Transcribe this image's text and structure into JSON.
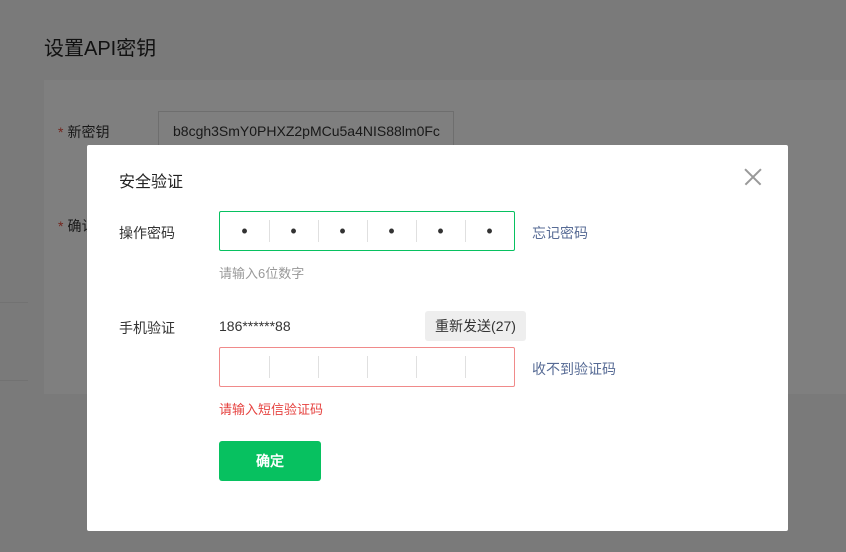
{
  "background": {
    "page_title": "设置API密钥",
    "new_key_label": "新密钥",
    "new_key_value": "b8cgh3SmY0PHXZ2pMCu5a4NIS88lm0Fc",
    "confirm_label_partial": "确认"
  },
  "modal": {
    "title": "安全验证",
    "password": {
      "label": "操作密码",
      "cells": [
        "•",
        "•",
        "•",
        "•",
        "•",
        "•"
      ],
      "hint": "请输入6位数字",
      "forgot_link": "忘记密码"
    },
    "phone": {
      "label": "手机验证",
      "number": "186******88",
      "resend_button": "重新发送(27)",
      "cells": [
        "",
        "",
        "",
        "",
        "",
        ""
      ],
      "error_hint": "请输入短信验证码",
      "no_code_link": "收不到验证码"
    },
    "confirm_button": "确定"
  },
  "colors": {
    "primary_green": "#07c160",
    "link_blue": "#576b95",
    "error_red": "#e64340"
  }
}
